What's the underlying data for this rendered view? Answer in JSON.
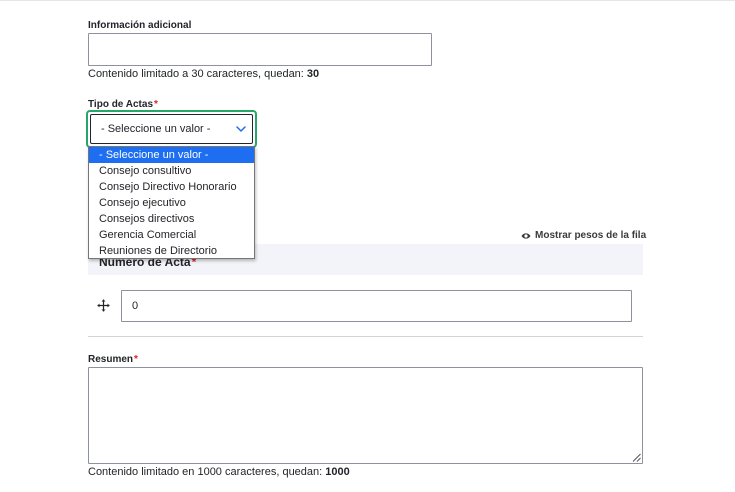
{
  "info_field": {
    "label": "Información adicional",
    "value": "",
    "description_prefix": "Contenido limitado a 30 caracteres, quedan: ",
    "remaining": "30"
  },
  "tipo_actas": {
    "label": "Tipo de Actas",
    "required_marker": "*",
    "selected_value": "- Seleccione un valor -",
    "options": [
      "- Seleccione un valor -",
      "Consejo consultivo",
      "Consejo Directivo Honorario",
      "Consejo ejecutivo",
      "Consejos directivos",
      "Gerencia Comercial",
      "Reuniones de Directorio"
    ]
  },
  "table": {
    "show_weights_label": "Mostrar pesos de la fila",
    "header_label": "Número de Acta",
    "required_marker": "*",
    "row_value": "0"
  },
  "resumen": {
    "label": "Resumen",
    "required_marker": "*",
    "value": "",
    "description_prefix": "Contenido limitado en 1000 caracteres, quedan: ",
    "remaining": "1000"
  },
  "colors": {
    "focus_ring": "#26a769",
    "selected_option": "#1e6ef2",
    "required": "#dc2323",
    "table_header_bg": "#f3f4f9"
  },
  "icons": {
    "select_arrow": "chevron-down-icon",
    "weights": "eye-icon",
    "drag": "drag-handle-icon",
    "resize": "resize-grip-icon"
  }
}
